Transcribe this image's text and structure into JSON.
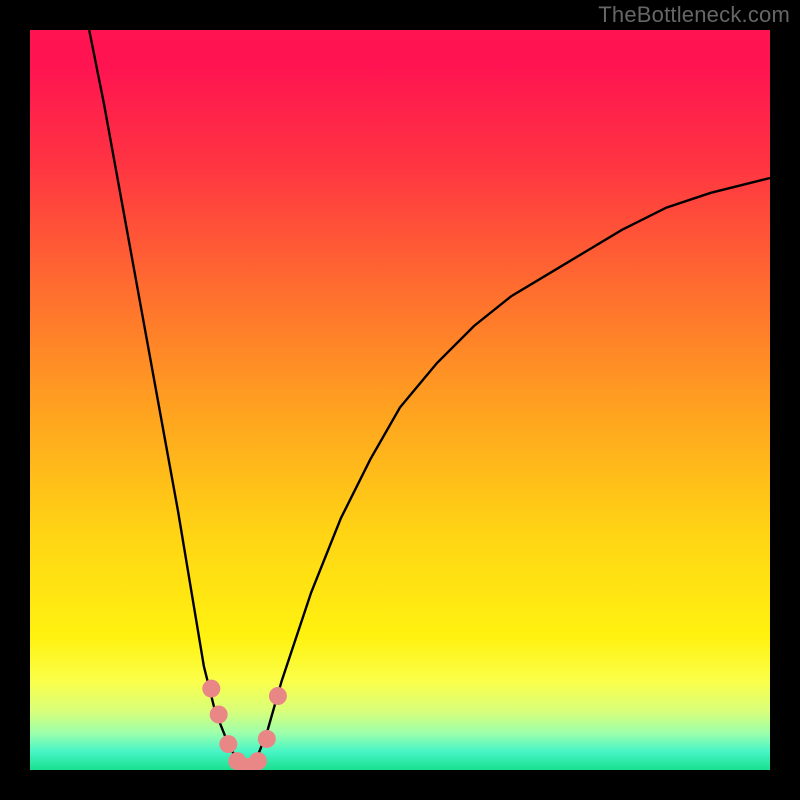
{
  "watermark": "TheBottleneck.com",
  "colors": {
    "frame_bg": "#000000",
    "curve": "#000000",
    "marker": "#e98787",
    "gradient_top": "#ff1451",
    "gradient_bottom": "#19e08e"
  },
  "chart_data": {
    "type": "line",
    "title": "",
    "xlabel": "",
    "ylabel": "",
    "xlim": [
      0,
      100
    ],
    "ylim": [
      0,
      100
    ],
    "legend": false,
    "grid": false,
    "series": [
      {
        "name": "left-curve",
        "x": [
          8,
          10,
          12,
          14,
          16,
          18,
          20,
          22,
          23.5,
          25,
          27,
          29
        ],
        "values": [
          100,
          90,
          79,
          68,
          57,
          46,
          35,
          23,
          14,
          8,
          3,
          0
        ]
      },
      {
        "name": "right-curve",
        "x": [
          30,
          32,
          34,
          36,
          38,
          42,
          46,
          50,
          55,
          60,
          65,
          70,
          75,
          80,
          86,
          92,
          100
        ],
        "values": [
          0,
          5,
          12,
          18,
          24,
          34,
          42,
          49,
          55,
          60,
          64,
          67,
          70,
          73,
          76,
          78,
          80
        ]
      }
    ],
    "markers": {
      "name": "highlighted-points",
      "series_index": null,
      "points": [
        {
          "x": 24.5,
          "y": 11
        },
        {
          "x": 25.5,
          "y": 7.5
        },
        {
          "x": 26.8,
          "y": 3.5
        },
        {
          "x": 28.0,
          "y": 1.2
        },
        {
          "x": 29.5,
          "y": 0.4
        },
        {
          "x": 30.8,
          "y": 1.2
        },
        {
          "x": 32.0,
          "y": 4.2
        },
        {
          "x": 33.5,
          "y": 10
        }
      ]
    },
    "annotations": []
  }
}
